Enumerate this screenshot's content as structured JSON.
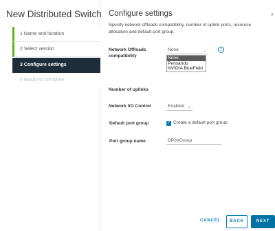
{
  "wizard": {
    "title": "New Distributed Switch",
    "steps": [
      {
        "label": "1  Name and location",
        "state": "done"
      },
      {
        "label": "2  Select version",
        "state": "done"
      },
      {
        "label": "3  Configure settings",
        "state": "active"
      },
      {
        "label": "4  Ready to complete",
        "state": "disabled"
      }
    ]
  },
  "page": {
    "title": "Configure settings",
    "close_glyph": "›",
    "description": "Specify network offloads compatibility, number of uplink ports, resource allocation and default port group."
  },
  "form": {
    "network_offloads": {
      "label": "Network Offloads compatibility",
      "value": "None",
      "info_glyph": "i",
      "options": [
        "None",
        "Pensando",
        "NVIDIA BlueField"
      ],
      "selected_option": "None"
    },
    "uplinks": {
      "label": "Number of uplinks"
    },
    "nioc": {
      "label": "Network I/O Control",
      "value": "Enabled"
    },
    "default_port_group": {
      "label": "Default port group",
      "checkbox_label": "Create a default port group",
      "checked": true
    },
    "port_group_name": {
      "label": "Port group name",
      "value": "DPortGroup"
    }
  },
  "footer": {
    "cancel_label": "CANCEL",
    "back_label": "BACK",
    "next_label": "NEXT"
  },
  "colors": {
    "accent": "#0079b8",
    "active_step_bg": "#1d2d3a",
    "done_marker": "#60b515"
  }
}
